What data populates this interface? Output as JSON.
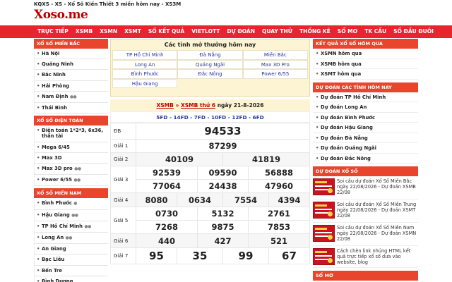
{
  "header": {
    "tagline": "KQXS - XS - Xổ Số Kiến Thiết 3 miền hôm nay - XS3M",
    "logo": "Xoso.me"
  },
  "nav": [
    "TRỰC TIẾP",
    "XSMB",
    "XSMN",
    "XSMT",
    "SỐ KẾT QUẢ",
    "VIETLOTT",
    "DỰ ĐOÁN",
    "QUAY THỬ",
    "THỐNG KÊ",
    "SỔ MƠ",
    "TK CẦU",
    "SỐ ĐẦU ĐUÔI"
  ],
  "left": {
    "mien_bac": {
      "title": "XỔ SỐ MIỀN BẮC",
      "items": [
        "Hà Nội",
        "Quảng Ninh",
        "Bắc Ninh",
        "Hải Phòng",
        "Nam Định",
        "Thái Bình"
      ]
    },
    "dien_toan": {
      "title": "XỔ SỐ ĐIỆN TOÁN",
      "items": [
        "Điện toán 1*2*3, 6x36, thần tài",
        "Mega 6/45",
        "Max 3D",
        "Max 3D pro",
        "Power 6/55"
      ]
    },
    "mien_nam": {
      "title": "XỔ SỐ MIỀN NAM",
      "items": [
        "Bình Phước",
        "Hậu Giang",
        "TP Hồ Chí Minh",
        "Long An",
        "An Giang",
        "Bạc Liêu",
        "Bến Tre",
        "Bình Dương"
      ]
    }
  },
  "today": {
    "title": "Các tỉnh mở thưởng hôm nay",
    "provinces": [
      "TP Hồ Chí Minh",
      "Đà Nẵng",
      "Miền Bắc",
      "Long An",
      "Quảng Ngãi",
      "Max 3D Pro",
      "Bình Phước",
      "Đắc Nông",
      "Power 6/55",
      "Hậu Giang"
    ]
  },
  "result": {
    "link1": "XSMB",
    "sep": "»",
    "link2": "XSMB thứ 6",
    "date_text": "ngày 21-8-2026",
    "codes": "5FD - 14FD - 7FD - 10FD - 12FD - 6FD",
    "labels": [
      "ĐB",
      "Giải 1",
      "Giải 2",
      "Giải 3",
      "Giải 4",
      "Giải 5",
      "Giải 6",
      "Giải 7"
    ],
    "db": "94533",
    "g1": "87299",
    "g2": [
      "40109",
      "41819"
    ],
    "g3": [
      "92539",
      "09590",
      "56888",
      "77064",
      "24438",
      "47960"
    ],
    "g4": [
      "8080",
      "0634",
      "7554",
      "4394"
    ],
    "g5": [
      "0730",
      "5132",
      "2761",
      "7268",
      "9875",
      "7853"
    ],
    "g6": [
      "440",
      "427",
      "521"
    ],
    "g7": [
      "95",
      "35",
      "99",
      "67"
    ]
  },
  "right": {
    "kq_title": "KẾT QUẢ XỔ SỐ HÔM QUA",
    "kq_items": [
      "XSMN hôm qua",
      "XSMB hôm qua",
      "XSMT hôm qua"
    ],
    "dd_title": "DỰ ĐOÁN CÁC TỈNH HÔM NAY",
    "dd_items": [
      "Dự đoán TP Hồ Chí Minh",
      "Dự đoán Long An",
      "Dự đoán Bình Phước",
      "Dự đoán Hậu Giang",
      "Dự đoán Đà Nẵng",
      "Dự đoán Quảng Ngãi",
      "Dự đoán Đắc Nông"
    ],
    "news_title": "DỰ ĐOÁN XỔ SỐ",
    "news": [
      "Soi cầu dự đoán Xổ Số Miền Bắc ngày 22/08/2026 - Dự đoán XSMB 22/08",
      "Soi cầu dự đoán Xổ Số Miền Trung ngày 22/08/2026 - Dự đoán XSMT 22/08",
      "Soi cầu dự đoán Xổ Số Miền Nam ngày 22/08/2026 - Dự đoán XSMN 22/08",
      "Cách chèn link nhúng HTML kết quả trực tiếp xổ số dưa vào website, blog"
    ],
    "somo_title": "SỔ MƠ"
  }
}
